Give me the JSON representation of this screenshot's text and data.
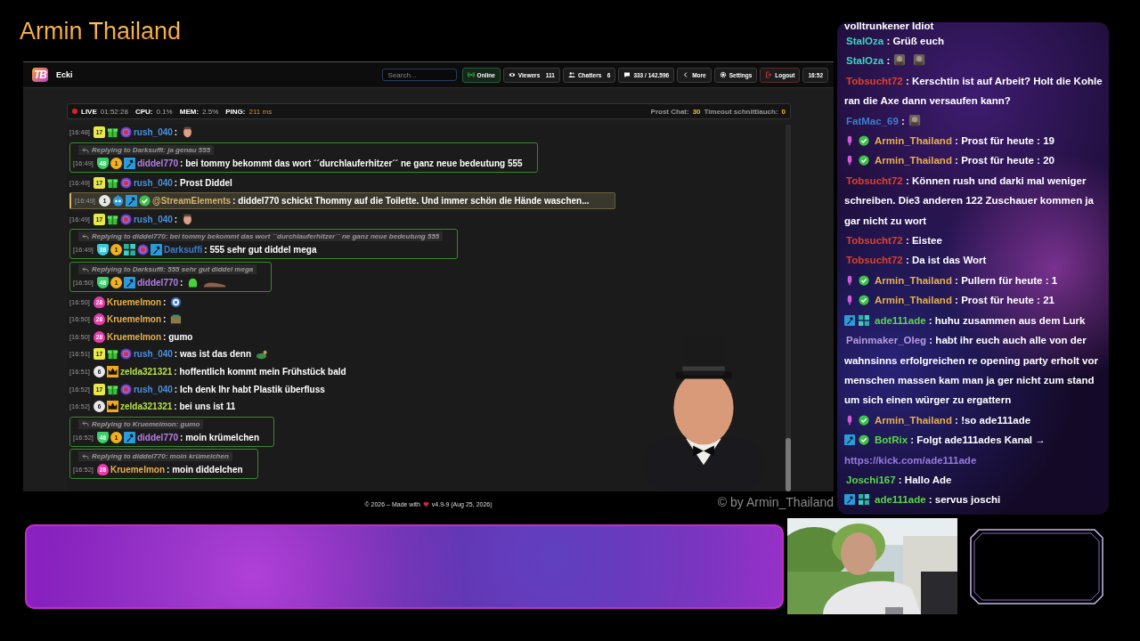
{
  "stream_title": "Armin Thailand",
  "app": {
    "logo": "TB",
    "name": "Ecki",
    "search": {
      "placeholder": "Search..."
    },
    "buttons": [
      {
        "kind": "online",
        "label": "Online"
      },
      {
        "kind": "viewers",
        "label": "Viewers",
        "count": "111"
      },
      {
        "kind": "chatters",
        "label": "Chatters",
        "count": "6"
      },
      {
        "kind": "messages",
        "label": "333 / 142.596"
      },
      {
        "kind": "more",
        "label": "More"
      },
      {
        "kind": "settings",
        "label": "Settings"
      },
      {
        "kind": "logout",
        "label": "Logout"
      },
      {
        "kind": "clock",
        "label": "16:52"
      }
    ],
    "status": {
      "live": "LIVE",
      "uptime": "01:52:28",
      "stats": [
        {
          "label": "CPU:",
          "value": "0.1%",
          "kind": "plain"
        },
        {
          "label": "MEM:",
          "value": "2.5%",
          "kind": "plain"
        },
        {
          "label": "PING:",
          "value": "211 ms",
          "kind": "warn"
        }
      ],
      "counters": [
        {
          "label": "Prost Chat:",
          "value": "30"
        },
        {
          "label": "Timeout schnittlauch:",
          "value": "0"
        }
      ]
    },
    "messages": [
      {
        "kind": "plain",
        "time": "[16:48]",
        "badges": [
          {
            "kind": "square",
            "text": "17",
            "color": "#e8e84a"
          },
          {
            "kind": "gift"
          },
          {
            "kind": "globe"
          }
        ],
        "user": "rush_040",
        "color": "#4a8fe0",
        "text": ":",
        "emotes": [
          {
            "kind": "face"
          }
        ]
      },
      {
        "kind": "reply",
        "reply": "Replying to Darksuffi: ja genau 555",
        "time": "[16:49]",
        "badges": [
          {
            "kind": "shield",
            "text": "48",
            "color": "#3ccf6a"
          },
          {
            "kind": "circle",
            "text": "1",
            "color": "#f0b020"
          },
          {
            "kind": "hammer"
          }
        ],
        "user": "diddel770",
        "color": "#b57fe6",
        "text": ": bei tommy bekommt das wort ´´durchlauferhitzer´´ ne ganz neue bedeutung 555"
      },
      {
        "kind": "plain",
        "time": "[16:49]",
        "badges": [
          {
            "kind": "square",
            "text": "17",
            "color": "#e8e84a"
          },
          {
            "kind": "gift"
          },
          {
            "kind": "globe"
          }
        ],
        "user": "rush_040",
        "color": "#4a8fe0",
        "text": ": Prost Diddel"
      },
      {
        "kind": "highlight",
        "time": "[16:49]",
        "badges": [
          {
            "kind": "circle",
            "text": "1",
            "color": "#e8e8e8"
          },
          {
            "kind": "robot"
          },
          {
            "kind": "hammer"
          },
          {
            "kind": "check"
          }
        ],
        "user": "@StreamElements",
        "color": "#d9b36a",
        "text": ": diddel770 schickt Thommy auf die Toilette. Und immer schön die Hände waschen..."
      },
      {
        "kind": "plain",
        "time": "[16:49]",
        "badges": [
          {
            "kind": "square",
            "text": "17",
            "color": "#e8e84a"
          },
          {
            "kind": "gift"
          },
          {
            "kind": "globe"
          }
        ],
        "user": "rush_040",
        "color": "#4a8fe0",
        "text": ":",
        "emotes": [
          {
            "kind": "face"
          }
        ]
      },
      {
        "kind": "reply",
        "reply": "Replying to diddel770: bei tommy bekommt das wort ´´durchlauferhitzer´´ ne ganz neue bedeutung 555",
        "time": "[16:49]",
        "badges": [
          {
            "kind": "shield",
            "text": "38",
            "color": "#3cc8d8"
          },
          {
            "kind": "circle",
            "text": "1",
            "color": "#f0b020"
          },
          {
            "kind": "grid"
          },
          {
            "kind": "globe"
          },
          {
            "kind": "hammer"
          }
        ],
        "user": "Darksuffi",
        "color": "#3a7fd0",
        "text": ": 555 sehr gut diddel mega"
      },
      {
        "kind": "reply",
        "reply": "Replying to Darksuffi: 555 sehr gut diddel mega",
        "time": "[16:50]",
        "badges": [
          {
            "kind": "shield",
            "text": "48",
            "color": "#3ccf6a"
          },
          {
            "kind": "circle",
            "text": "1",
            "color": "#f0b020"
          },
          {
            "kind": "hammer"
          }
        ],
        "user": "diddel770",
        "color": "#b57fe6",
        "text": ":",
        "emotes": [
          {
            "kind": "blob"
          },
          {
            "kind": "log"
          }
        ]
      },
      {
        "kind": "plain",
        "time": "[16:50]",
        "badges": [
          {
            "kind": "drop",
            "text": "28",
            "color": "#e83aa8"
          }
        ],
        "user": "Kruemelmon",
        "color": "#e8b04a",
        "text": ":",
        "emotes": [
          {
            "kind": "ball"
          }
        ]
      },
      {
        "kind": "plain",
        "time": "[16:50]",
        "badges": [
          {
            "kind": "drop",
            "text": "28",
            "color": "#e83aa8"
          }
        ],
        "user": "Kruemelmon",
        "color": "#e8b04a",
        "text": ":",
        "emotes": [
          {
            "kind": "box"
          }
        ]
      },
      {
        "kind": "plain",
        "time": "[16:50]",
        "badges": [
          {
            "kind": "drop",
            "text": "28",
            "color": "#e83aa8"
          }
        ],
        "user": "Kruemelmon",
        "color": "#e8b04a",
        "text": ": gumo"
      },
      {
        "kind": "plain",
        "time": "[16:51]",
        "badges": [
          {
            "kind": "square",
            "text": "17",
            "color": "#e8e84a"
          },
          {
            "kind": "gift"
          },
          {
            "kind": "globe"
          }
        ],
        "user": "rush_040",
        "color": "#4a8fe0",
        "text": ": was ist das denn",
        "emotes": [
          {
            "kind": "turtle"
          }
        ]
      },
      {
        "kind": "plain",
        "time": "[16:51]",
        "badges": [
          {
            "kind": "circle",
            "text": "6",
            "color": "#e8e8e8"
          },
          {
            "kind": "crown"
          }
        ],
        "user": "zelda321321",
        "color": "#b8e04a",
        "text": ": hoffentlich kommt mein Frühstück bald"
      },
      {
        "kind": "plain",
        "time": "[16:52]",
        "badges": [
          {
            "kind": "square",
            "text": "17",
            "color": "#e8e84a"
          },
          {
            "kind": "gift"
          },
          {
            "kind": "globe"
          }
        ],
        "user": "rush_040",
        "color": "#4a8fe0",
        "text": ": Ich denk Ihr habt Plastik überfluss"
      },
      {
        "kind": "plain",
        "time": "[16:52]",
        "badges": [
          {
            "kind": "circle",
            "text": "6",
            "color": "#e8e8e8"
          },
          {
            "kind": "crown"
          }
        ],
        "user": "zelda321321",
        "color": "#b8e04a",
        "text": ": bei uns ist 11"
      },
      {
        "kind": "reply",
        "reply": "Replying to Kruemelmon: gumo",
        "time": "[16:52]",
        "badges": [
          {
            "kind": "shield",
            "text": "48",
            "color": "#3ccf6a"
          },
          {
            "kind": "circle",
            "text": "1",
            "color": "#f0b020"
          },
          {
            "kind": "hammer"
          }
        ],
        "user": "diddel770",
        "color": "#b57fe6",
        "text": ": moin krümelchen"
      },
      {
        "kind": "reply",
        "reply": "Replying to diddel770: moin krümelchen",
        "time": "[16:52]",
        "badges": [
          {
            "kind": "drop",
            "text": "28",
            "color": "#e83aa8"
          }
        ],
        "user": "Kruemelmon",
        "color": "#e8b04a",
        "text": ": moin diddelchen"
      }
    ],
    "footer": {
      "before": "© 2026 – Made with",
      "after": "v4.9-9 (Aug 25, 2026)"
    },
    "watermark_credit": "© by Armin_Thailand"
  },
  "side_chat": [
    {
      "text": "volltrunkener Idiot"
    },
    {
      "user": "StalOza",
      "color": "#3ad6c8",
      "text": ": Grüß euch"
    },
    {
      "user": "StalOza",
      "color": "#3ad6c8",
      "text": ":"
    },
    {
      "user": "Tobsucht72",
      "color": "#e0402a",
      "text": ": Kerschtin ist auf Arbeit? Holt die Kohle ran die Axe dann versaufen kann?"
    },
    {
      "user": "FatMac_69",
      "color": "#3a7fd0",
      "text": ":"
    },
    {
      "user": "Armin_Thailand",
      "color": "#e8b04a",
      "text": ": Prost für heute : 19",
      "badges": [
        {
          "kind": "mic"
        },
        {
          "kind": "check"
        }
      ]
    },
    {
      "user": "Armin_Thailand",
      "color": "#e8b04a",
      "text": ": Prost für heute : 20",
      "badges": [
        {
          "kind": "mic"
        },
        {
          "kind": "check"
        }
      ]
    },
    {
      "user": "Tobsucht72",
      "color": "#e0402a",
      "text": ": Können rush und darki mal weniger schreiben. Die3 anderen 122 Zuschauer kommen ja gar nicht zu wort"
    },
    {
      "user": "Tobsucht72",
      "color": "#e0402a",
      "text": ": Eistee"
    },
    {
      "user": "Tobsucht72",
      "color": "#e0402a",
      "text": ": Da ist das Wort"
    },
    {
      "user": "Armin_Thailand",
      "color": "#e8b04a",
      "text": ": Pullern für heute : 1",
      "badges": [
        {
          "kind": "mic"
        },
        {
          "kind": "check"
        }
      ]
    },
    {
      "user": "Armin_Thailand",
      "color": "#e8b04a",
      "text": ": Prost für heute : 21",
      "badges": [
        {
          "kind": "mic"
        },
        {
          "kind": "check"
        }
      ]
    },
    {
      "user": "ade111ade",
      "color": "#5ad64a",
      "text": ": huhu zusammen aus dem Lurk",
      "badges": [
        {
          "kind": "hammer"
        },
        {
          "kind": "grid"
        }
      ]
    },
    {
      "user": "Painmaker_Oleg",
      "color": "#b89ae0",
      "text": ": habt ihr euch auch alle von der wahnsinns erfolgreichen re opening party erholt vor menschen massen kam man ja ger nicht zum stand um sich einen würger zu ergattern"
    },
    {
      "user": "Armin_Thailand",
      "color": "#e8b04a",
      "text": ": !so ade111ade",
      "badges": [
        {
          "kind": "mic"
        },
        {
          "kind": "check"
        }
      ]
    },
    {
      "user": "BotRix",
      "color": "#5ad64a",
      "text": ": Folgt ade111ades Kanal →",
      "link": "https://kick.com/ade111ade",
      "badges": [
        {
          "kind": "hammer"
        },
        {
          "kind": "check"
        }
      ]
    },
    {
      "user": "Joschi167",
      "color": "#5ad64a",
      "text": ": Hallo Ade"
    },
    {
      "user": "ade111ade",
      "color": "#5ad64a",
      "text": ": servus joschi",
      "badges": [
        {
          "kind": "hammer"
        },
        {
          "kind": "grid"
        }
      ]
    }
  ]
}
